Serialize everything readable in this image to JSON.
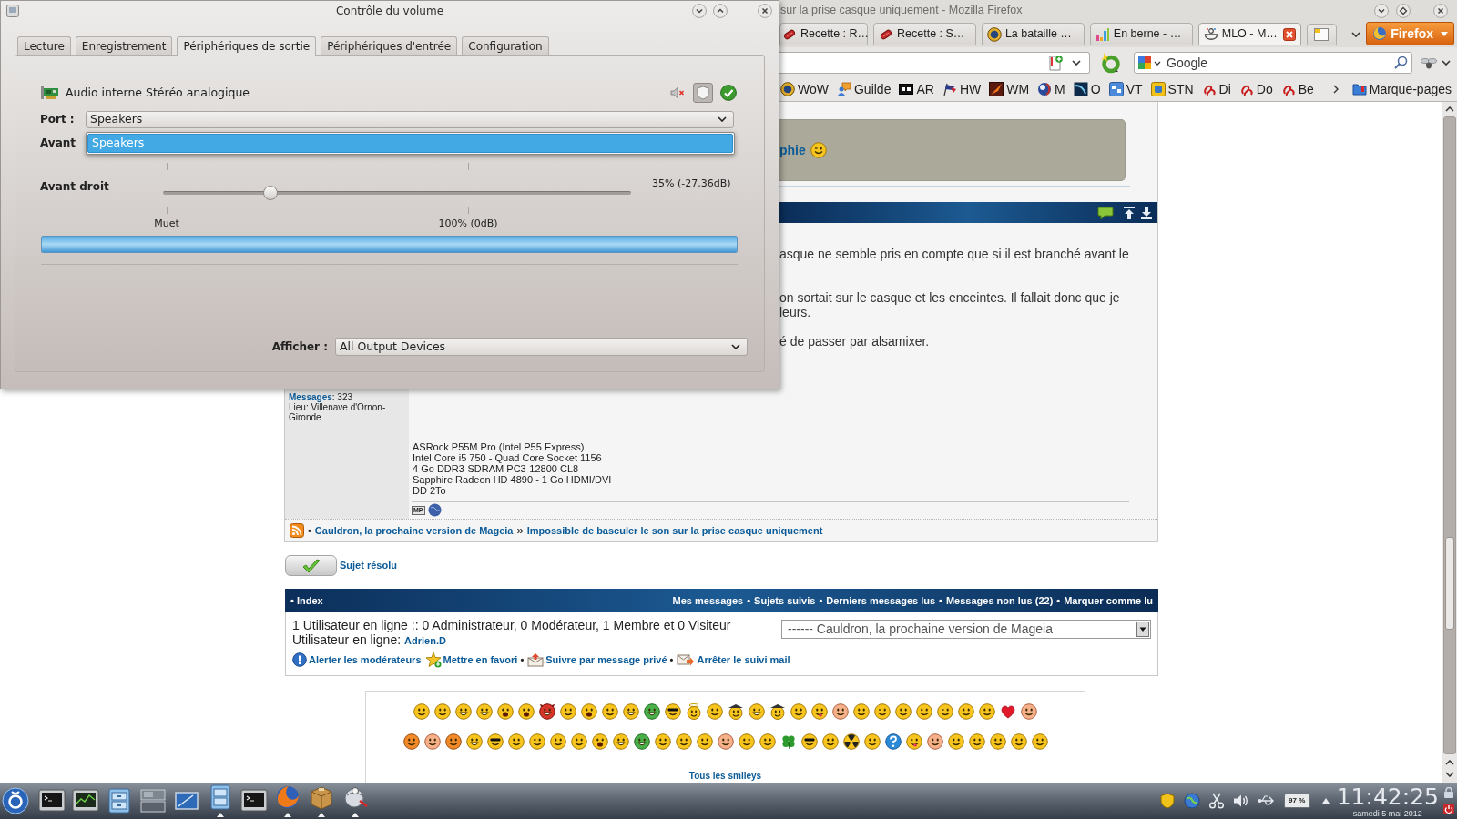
{
  "volume_dialog": {
    "title": "Contrôle du volume",
    "tabs": [
      {
        "label": "Lecture",
        "selected": false
      },
      {
        "label": "Enregistrement",
        "selected": false
      },
      {
        "label": "Périphériques de sortie",
        "selected": true
      },
      {
        "label": "Périphériques d'entrée",
        "selected": false
      },
      {
        "label": "Configuration",
        "selected": false
      }
    ],
    "device": {
      "name": "Audio interne Stéréo analogique",
      "locked": true
    },
    "port": {
      "label": "Port :",
      "value": "Speakers",
      "expanded": true,
      "options": [
        {
          "label": "Speakers",
          "selected": true
        }
      ]
    },
    "channels": [
      {
        "name": "Avant"
      },
      {
        "name": "Avant droit",
        "level": 0.23,
        "reading": "35% (-27,36dB)"
      }
    ],
    "scale": [
      "Muet",
      "100% (0dB)"
    ],
    "meter": {
      "level": 1
    },
    "show": {
      "label": "Afficher :",
      "value": "All Output Devices"
    }
  },
  "browser": {
    "title": "sur la prise casque uniquement - Mozilla Firefox",
    "tabs": [
      {
        "label": "Recette : R…",
        "selected": false
      },
      {
        "label": "Recette : S…",
        "selected": false
      },
      {
        "label": "La bataille …",
        "selected": false
      },
      {
        "label": "En berne - …",
        "selected": false
      },
      {
        "label": "MLO - M…",
        "selected": true
      }
    ],
    "menu_button": "Firefox",
    "search": {
      "placeholder": "Google"
    },
    "bookmarks": [
      "WoW",
      "Guilde",
      "AR",
      "HW",
      "WM",
      "M",
      "O",
      "VT",
      "STN",
      "Di",
      "Do",
      "Be"
    ],
    "bookmarks_menu": "Marque-pages"
  },
  "page": {
    "quote": {
      "link": "phie"
    },
    "post": {
      "lines": [
        "asque ne semble pris en compte que si il est branché avant le",
        "on sortait sur le casque et les enceintes. Il fallait donc que je",
        "leurs.",
        "é de passer par alsamixer."
      ],
      "author": {
        "messages": "**Messages**: 323",
        "location": "Lieu: Villenave d'Ornon-Gironde"
      },
      "signature": [
        "ASRock P55M Pro (Intel P55 Express)",
        "Intel Core i5 750 - Quad Core Socket 1156",
        "4 Go DDR3-SDRAM PC3-12800 CL8",
        "Sapphire Radeon HD 4890 - 1 Go HDMI/DVI",
        "DD 2To"
      ],
      "pm_badge": "MP"
    },
    "breadcrumb": {
      "bullet": "•",
      "separator": "»",
      "items": [
        "Cauldron, la prochaine version de Mageia",
        "Impossible de basculer le son sur la prise casque uniquement"
      ]
    },
    "resolved": {
      "label": "Sujet résolu"
    },
    "nav": {
      "index": "• Index",
      "separator": "•",
      "links": [
        "Mes messages",
        "Sujets suivis",
        "Derniers messages lus",
        "Messages non lus (22)",
        "Marquer comme lu"
      ]
    },
    "online": {
      "summary": "1 Utilisateur en ligne :: 0 Administrateur, 0 Modérateur, 1 Membre et 0 Visiteur",
      "users_label": "Utilisateur en ligne:",
      "users": [
        "Adrien.D"
      ]
    },
    "jump": {
      "value": "------ Cauldron, la prochaine version de Mageia"
    },
    "actions": [
      {
        "kind": "alert",
        "label": "Alerter les modérateurs"
      },
      {
        "kind": "favorite",
        "label": "Mettre en favori"
      },
      {
        "kind": "pm",
        "label": "Suivre par message privé",
        "separator": "•"
      },
      {
        "kind": "mail",
        "label": "Arrêter le suivi mail",
        "separator": "•"
      }
    ],
    "smileys_link": "Tous les smileys"
  },
  "taskbar": {
    "battery": "97 %",
    "clock": "11:42:25",
    "date": "samedi 5 mai 2012"
  }
}
